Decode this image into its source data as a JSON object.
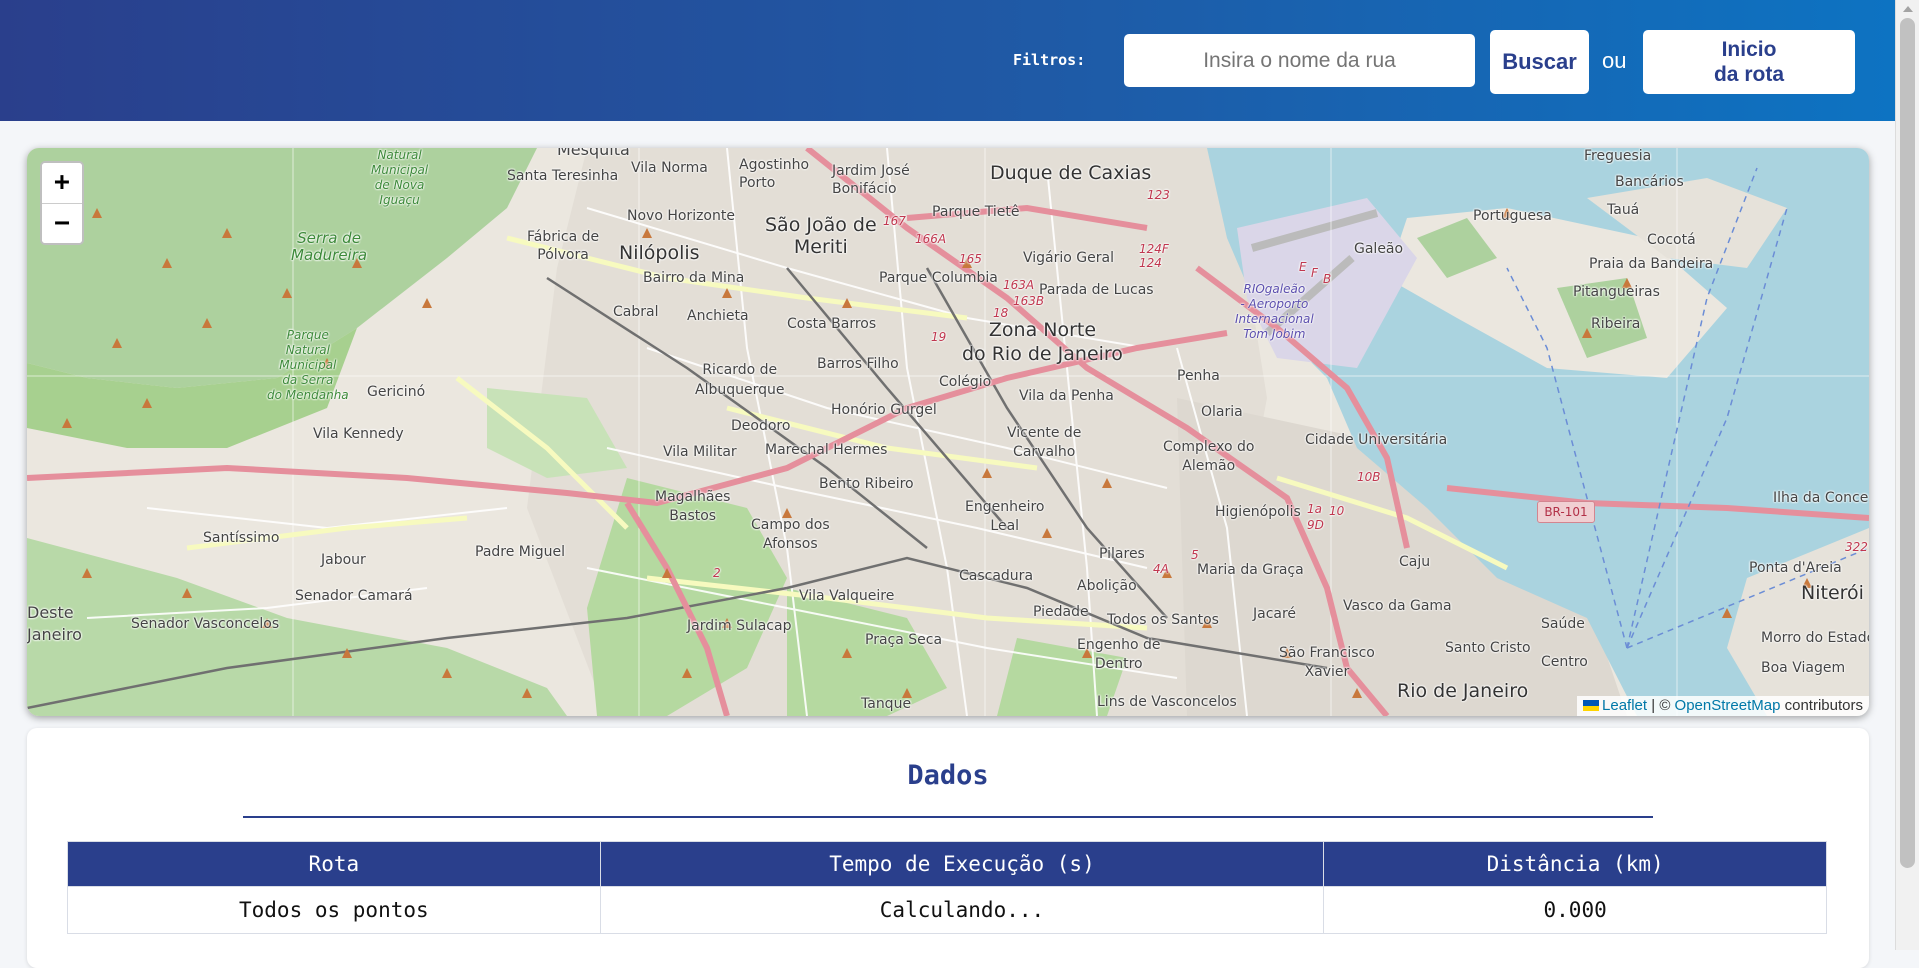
{
  "header": {
    "filters_label": "Filtros:",
    "search_placeholder": "Insira o nome da rua",
    "search_value": "",
    "search_button_label": "Buscar",
    "or_text": "ou",
    "route_start_button_label": "Inicio\nda rota"
  },
  "map": {
    "zoom_in_label": "+",
    "zoom_out_label": "−",
    "attribution": {
      "leaflet_label": "Leaflet",
      "separator": "| ©",
      "osm_label": "OpenStreetMap",
      "suffix": "contributors"
    },
    "highway_shield": "BR-101",
    "place_labels": {
      "mesquita": "Mesquita",
      "vila_norma": "Vila Norma",
      "agostinho_porto": "Agostinho\nPorto",
      "jardim_jose_bonifacio": "Jardim José\nBonifácio",
      "duque_de_caxias": "Duque de Caxias",
      "freguesia": "Freguesia",
      "santa_teresinha": "Santa Teresinha",
      "bancarios": "Bancários",
      "fabrica_de_polvora": "Fábrica de\nPólvora",
      "novo_horizonte": "Novo Horizonte",
      "sao_joao_de_meriti": "São João de\nMeriti",
      "parque_tiete": "Parque Tietê",
      "portuguesa": "Portuguesa",
      "taua": "Tauá",
      "cocota": "Cocotá",
      "galeao": "Galeão",
      "praia_da_bandeira": "Praia da Bandeira",
      "nilopolis": "Nilópolis",
      "vigario_geral": "Vigário Geral",
      "pitangueiras": "Pitangueiras",
      "bairro_da_mina": "Bairro da Mina",
      "parque_columbia": "Parque Columbia",
      "parada_de_lucas": "Parada de Lucas",
      "cabral": "Cabral",
      "anchieta": "Anchieta",
      "costa_barros": "Costa Barros",
      "ribeira": "Ribeira",
      "zona_norte": "Zona Norte\ndo Rio de Janeiro",
      "ricardo_de_albuquerque": "Ricardo de\nAlbuquerque",
      "barros_filho": "Barros Filho",
      "gericino": "Gericinó",
      "penha": "Penha",
      "colegio": "Colégio",
      "vila_da_penha": "Vila da Penha",
      "honorio_gurgel": "Honório Gurgel",
      "olaria": "Olaria",
      "deodoro": "Deodoro",
      "vila_kennedy": "Vila Kennedy",
      "cidade_universitaria": "Cidade Universitária",
      "vicente_de_carvalho": "Vicente de\nCarvalho",
      "vila_militar": "Vila Militar",
      "marechal_hermes": "Marechal Hermes",
      "complexo_do_alemao": "Complexo do\nAlemão",
      "bento_ribeiro": "Bento Ribeiro",
      "magalhaes_bastos": "Magalhães\nBastos",
      "engenheiro_leal": "Engenheiro\nLeal",
      "higienopolis": "Higienópolis",
      "ilha_da_conceicao": "Ilha da Conce",
      "santissimo": "Santíssimo",
      "campo_dos_afonsos": "Campo dos\nAfonsos",
      "padre_miguel": "Padre Miguel",
      "jabour": "Jabour",
      "pilares": "Pilares",
      "maria_da_graca": "Maria da Graça",
      "caju": "Caju",
      "ponta_dareia": "Ponta d'Areia",
      "cascadura": "Cascadura",
      "abolicao": "Abolição",
      "niteroi": "Niterói",
      "senador_camara": "Senador Camará",
      "vila_valqueire": "Vila Valqueire",
      "vasco_da_gama": "Vasco da Gama",
      "deste_janeiro": "Deste\nJaneiro",
      "piedade": "Piedade",
      "jacare": "Jacaré",
      "senador_vasconcelos": "Senador Vasconcelos",
      "jardim_sulacap": "Jardim Sulacap",
      "todos_os_santos": "Todos os Santos",
      "saude": "Saúde",
      "santo_cristo": "Santo Cristo",
      "morro_do_estado": "Morro do Estado",
      "praca_seca": "Praça Seca",
      "engenho_de_dentro": "Engenho de\nDentro",
      "sao_francisco_xavier": "São Francisco\nXavier",
      "centro": "Centro",
      "boa_viagem": "Boa Viagem",
      "rio_de_janeiro": "Rio de Janeiro",
      "tanque": "Tanque",
      "lins_de_vasconcelos": "Lins de Vasconcelos",
      "serra_de_madureira": "Serra de\nMadureira",
      "parque_municipal_nova_iguacu": "Natural\nMunicipal\nde Nova\nIguaçu",
      "parque_mendanha": "Parque\nNatural\nMunicipal\nda Serra\ndo Mendanha",
      "aeroporto": "RIOgaleão\n- Aeroporto\nInternacional\nTom Jobim"
    },
    "road_numbers": [
      "123",
      "167",
      "166A",
      "165",
      "163A",
      "163B",
      "18",
      "19",
      "124",
      "124F",
      "E",
      "F",
      "B",
      "10B",
      "1a",
      "10",
      "9D",
      "4A",
      "5",
      "2",
      "322"
    ]
  },
  "data_panel": {
    "title": "Dados",
    "table": {
      "columns": [
        "Rota",
        "Tempo de Execução (s)",
        "Distância (km)"
      ],
      "rows": [
        [
          "Todos os pontos",
          "Calculando...",
          "0.000"
        ]
      ]
    }
  },
  "colors": {
    "header_start": "#2a3f8c",
    "header_end": "#0d73c2",
    "accent": "#2a3f8c",
    "table_header_bg": "#2a3f8c",
    "water": "#aad3df",
    "park": "#a7d08f",
    "motorway": "#e58f9c"
  }
}
